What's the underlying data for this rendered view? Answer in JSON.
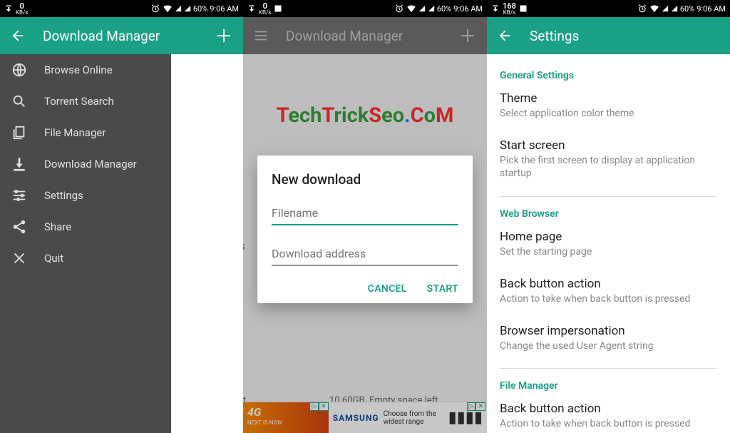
{
  "status": {
    "kb_label": "KB/s",
    "p1_kb": "0",
    "p2_kb": "0",
    "p3_kb": "168",
    "battery": "60%",
    "time": "9:06 AM"
  },
  "panel1": {
    "title": "Download Manager",
    "drawer": [
      {
        "label": "Browse Online"
      },
      {
        "label": "Torrent Search"
      },
      {
        "label": "File Manager"
      },
      {
        "label": "Download Manager"
      },
      {
        "label": "Settings"
      },
      {
        "label": "Share"
      },
      {
        "label": "Quit"
      }
    ]
  },
  "panel2": {
    "title": "Download Manager",
    "dialog": {
      "heading": "New download",
      "filename_ph": "Filename",
      "address_ph": "Download address",
      "cancel": "CANCEL",
      "start": "START"
    },
    "bottom_left": "eft",
    "bottom_right_val": "10.60GB",
    "bottom_right_lbl": "Empty space left",
    "stray": "s",
    "ad1_g": "4G",
    "ad1_txt": "NEXT IS NOW",
    "ad2_brand": "SAMSUNG",
    "ad2_txt": "Choose from the widest range"
  },
  "panel3": {
    "title": "Settings",
    "sections": {
      "general": {
        "header": "General Settings",
        "theme_t": "Theme",
        "theme_d": "Select application color theme",
        "start_t": "Start screen",
        "start_d": "Pick the first screen to display at application startup"
      },
      "web": {
        "header": "Web Browser",
        "home_t": "Home page",
        "home_d": "Set the starting page",
        "back_t": "Back button action",
        "back_d": "Action to take when back button is pressed",
        "imp_t": "Browser impersonation",
        "imp_d": "Change the used User Agent string"
      },
      "file": {
        "header": "File Manager",
        "back_t": "Back button action",
        "back_d": "Action to take when back button is pressed"
      }
    }
  },
  "watermark": {
    "t": "T",
    "ech": "ech",
    "t2": "T",
    "rick": "rick",
    "s": "S",
    "eo": "eo",
    "dot1": ".",
    "c": "C",
    "o": "o",
    "m": "M"
  }
}
